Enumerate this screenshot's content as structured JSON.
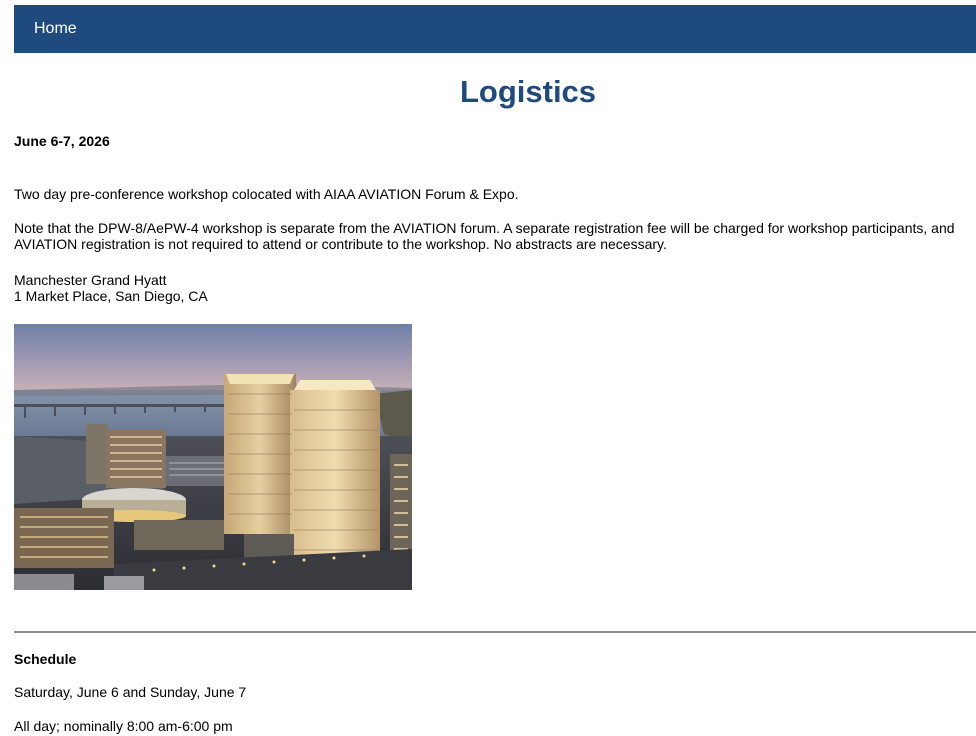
{
  "nav": {
    "home_label": "Home"
  },
  "page": {
    "title": "Logistics",
    "date": "June 6-7, 2026",
    "intro": "Two day pre-conference workshop colocated with AIAA AVIATION Forum & Expo.",
    "note": "Note that the DPW-8/AePW-4 workshop is separate from the AVIATION forum. A separate registration fee will be charged for workshop participants, and AVIATION registration is not required to attend or contribute to the workshop. No abstracts are necessary.",
    "venue_name": "Manchester Grand Hyatt",
    "venue_address": "1 Market Place, San Diego, CA"
  },
  "schedule": {
    "heading": "Schedule",
    "days": "Saturday, June 6 and Sunday, June 7",
    "hours": "All day; nominally 8:00 am-6:00 pm"
  },
  "colors": {
    "nav_background": "#1f4a7e",
    "title": "#1f4a7e",
    "divider": "#8a8a8a"
  }
}
